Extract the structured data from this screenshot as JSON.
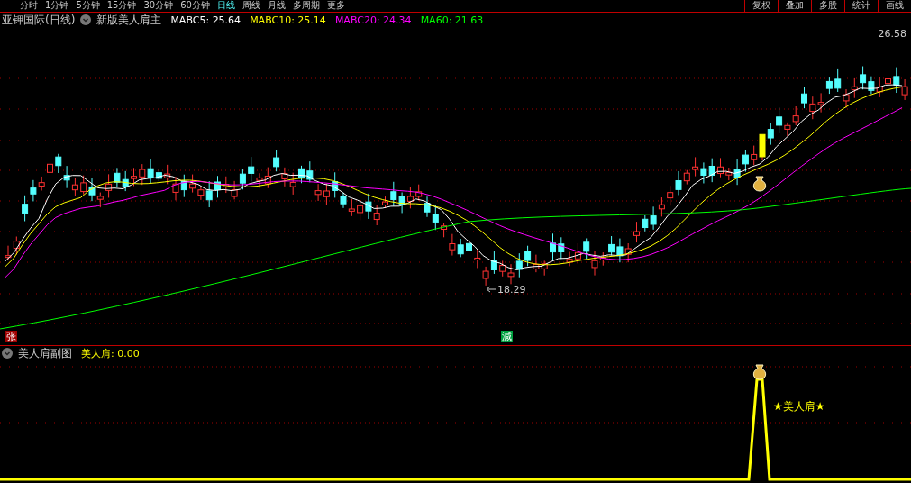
{
  "toolbar": {
    "tabs": [
      {
        "label": "分时",
        "selected": false
      },
      {
        "label": "1分钟",
        "selected": false
      },
      {
        "label": "5分钟",
        "selected": false
      },
      {
        "label": "15分钟",
        "selected": false
      },
      {
        "label": "30分钟",
        "selected": false
      },
      {
        "label": "60分钟",
        "selected": false
      },
      {
        "label": "日线",
        "selected": true
      },
      {
        "label": "周线",
        "selected": false
      },
      {
        "label": "月线",
        "selected": false
      },
      {
        "label": "多周期",
        "selected": false
      },
      {
        "label": "更多",
        "selected": false
      }
    ],
    "buttons": [
      "复权",
      "叠加",
      "多股",
      "统计",
      "画线"
    ]
  },
  "main_panel": {
    "title": "亚钾国际(日线)",
    "indicator": "新版美人肩主",
    "ma_readings": [
      {
        "label": "MABC5: 25.64",
        "color": "#ffffff"
      },
      {
        "label": "MABC10: 25.14",
        "color": "#ffff00"
      },
      {
        "label": "MABC20: 24.34",
        "color": "#ff00ff"
      },
      {
        "label": "MA60: 21.63",
        "color": "#00ff00"
      }
    ],
    "price_high": "26.58",
    "price_low": "18.29",
    "badges": [
      {
        "label": "张",
        "color": "#a00000"
      },
      {
        "label": "減",
        "color": "#00a040"
      }
    ]
  },
  "sub_panel": {
    "title": "美人肩副图",
    "reading": "美人肩: 0.00",
    "signal_label": "★美人肩★"
  }
}
